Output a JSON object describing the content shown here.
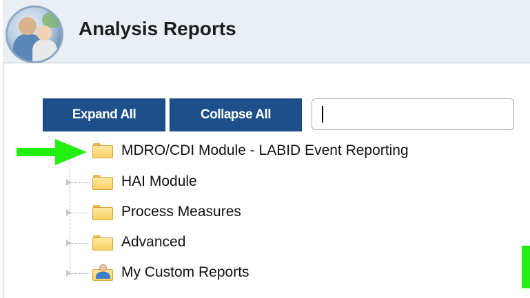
{
  "header": {
    "title": "Analysis Reports",
    "logo_icon": "people-photo-logo"
  },
  "toolbar": {
    "expand_label": "Expand All",
    "collapse_label": "Collapse All",
    "search_value": ""
  },
  "tree": {
    "items": [
      {
        "label": "MDRO/CDI Module - LABID Event Reporting",
        "icon": "folder-icon"
      },
      {
        "label": "HAI Module",
        "icon": "folder-icon"
      },
      {
        "label": "Process Measures",
        "icon": "folder-icon"
      },
      {
        "label": "Advanced",
        "icon": "folder-icon"
      },
      {
        "label": "My Custom Reports",
        "icon": "custom-reports-folder-icon"
      }
    ]
  },
  "annotations": {
    "arrow_color": "#22ee11"
  },
  "colors": {
    "button_bg": "#1d4f8b",
    "header_bg": "#e9eff5"
  }
}
